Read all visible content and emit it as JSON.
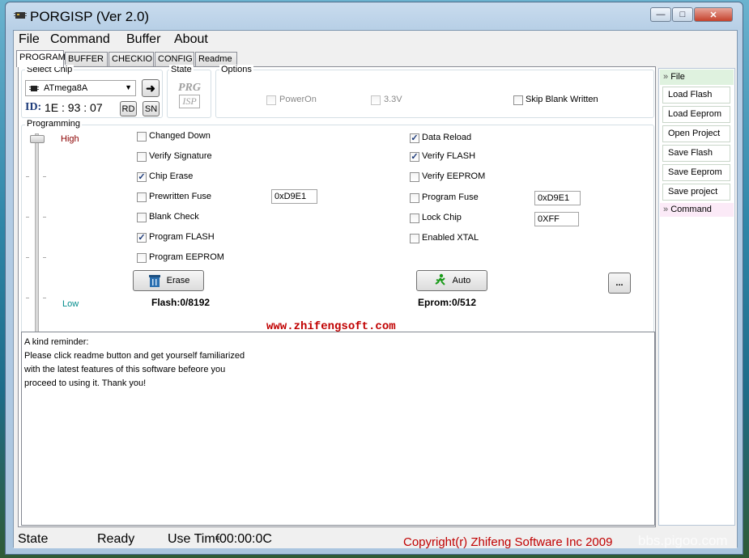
{
  "window": {
    "title": "PORGISP (Ver 2.0)"
  },
  "menu": [
    "File",
    "Command",
    "Buffer",
    "About"
  ],
  "tabs": [
    "PROGRAM",
    "BUFFER",
    "CHECKIO",
    "CONFIG",
    "Readme"
  ],
  "select_chip": {
    "label": "Select Chip",
    "chip": "ATmega8A",
    "id_label": "ID:",
    "id_value": "1E : 93 : 07",
    "rd": "RD",
    "sn": "SN"
  },
  "state": {
    "label": "State",
    "logo_top": "PRG",
    "logo_bottom": "ISP"
  },
  "options": {
    "label": "Options",
    "items": [
      {
        "label": "PowerOn",
        "checked": false,
        "enabled": false
      },
      {
        "label": "3.3V",
        "checked": false,
        "enabled": false
      },
      {
        "label": "Skip Blank Written",
        "checked": false,
        "enabled": true
      }
    ]
  },
  "programming": {
    "label": "Programming",
    "speed_high": "High",
    "speed_low": "Low",
    "left_checks": [
      {
        "label": "Changed Down",
        "checked": false
      },
      {
        "label": "Verify Signature",
        "checked": false
      },
      {
        "label": "Chip Erase",
        "checked": true
      },
      {
        "label": "Prewritten Fuse",
        "checked": false
      },
      {
        "label": "Blank Check",
        "checked": false
      },
      {
        "label": "Program FLASH",
        "checked": true
      },
      {
        "label": "Program EEPROM",
        "checked": false
      }
    ],
    "right_checks": [
      {
        "label": "Data Reload",
        "checked": true
      },
      {
        "label": "Verify FLASH",
        "checked": true
      },
      {
        "label": "Verify EEPROM",
        "checked": false
      },
      {
        "label": "Program Fuse",
        "checked": false
      },
      {
        "label": "Lock Chip",
        "checked": false
      },
      {
        "label": "Enabled XTAL",
        "checked": false
      }
    ],
    "prewritten_fuse_value": "0xD9E1",
    "program_fuse_value": "0xD9E1",
    "lock_value": "0XFF",
    "erase_button": "Erase",
    "auto_button": "Auto",
    "more_button": "...",
    "flash_info": "Flash:0/8192",
    "eeprom_info": "Eprom:0/512"
  },
  "website": "www.zhifengsoft.com",
  "log_lines": [
    "A kind reminder:",
    "Please click readme button and get yourself familiarized",
    "with the latest features of this software befeore you",
    "proceed to using it. Thank you!"
  ],
  "side_panel": {
    "file_header": "File",
    "buttons": [
      "Load Flash",
      "Load Eeprom",
      "Open Project",
      "Save Flash",
      "Save Eeprom",
      "Save project"
    ],
    "command_header": "Command"
  },
  "status": {
    "state": "State",
    "ready": "Ready",
    "use_time_label": "Use Tim€",
    "use_time_value": "00:00:0C",
    "copyright": "Copyright(r) Zhifeng Software Inc 2009",
    "watermark": "bbs.pigoo.com"
  },
  "colors": {
    "high": "#8b0000",
    "low": "#008b8b",
    "website": "#c00000",
    "copyright": "#c00000",
    "sidehead": "#dff2df"
  }
}
